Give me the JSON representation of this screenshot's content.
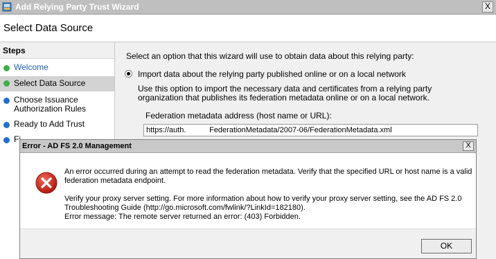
{
  "window": {
    "title": "Add Relying Party Trust Wizard",
    "close_glyph": "X",
    "icon": "wizard-app-icon"
  },
  "header": {
    "title": "Select Data Source"
  },
  "steps": {
    "heading": "Steps",
    "items": [
      {
        "label": "Welcome",
        "status": "done",
        "color": "#3cb043"
      },
      {
        "label": "Select Data Source",
        "status": "current",
        "color": "#3cb043"
      },
      {
        "label": "Choose Issuance Authorization Rules",
        "status": "pending",
        "color": "#1f6fd1"
      },
      {
        "label": "Ready to Add Trust",
        "status": "pending",
        "color": "#1f6fd1"
      },
      {
        "label": "Fi",
        "status": "pending",
        "color": "#1f6fd1"
      }
    ]
  },
  "content": {
    "intro": "Select an option that this wizard will use to obtain data about this relying party:",
    "option1": {
      "label": "Import data about the relying party published online or on a local network",
      "selected": true,
      "description": "Use this option to import the necessary data and certificates from a relying party organization that publishes its federation metadata online or on a local network."
    },
    "field_label": "Federation metadata address (host name or URL):",
    "field_value": "https://auth.           FederationMetadata/2007-06/FederationMetadata.xml"
  },
  "dialog": {
    "title": "Error - AD FS 2.0 Management",
    "close_glyph": "X",
    "icon": "error-icon",
    "line1": "An error occurred during an attempt to read the federation metadata.  Verify that the specified URL or host name is a valid",
    "line2": "federation metadata endpoint.",
    "line3": "Verify your proxy server setting. For more information about how to verify your proxy server setting, see the AD FS 2.0",
    "line4": "Troubleshooting Guide (http://go.microsoft.com/fwlink/?LinkId=182180).",
    "line5": "Error message: The remote server returned an error: (403) Forbidden.",
    "ok_label": "OK"
  },
  "colors": {
    "error_red": "#d9261c",
    "link_blue": "#1f5fbf"
  }
}
